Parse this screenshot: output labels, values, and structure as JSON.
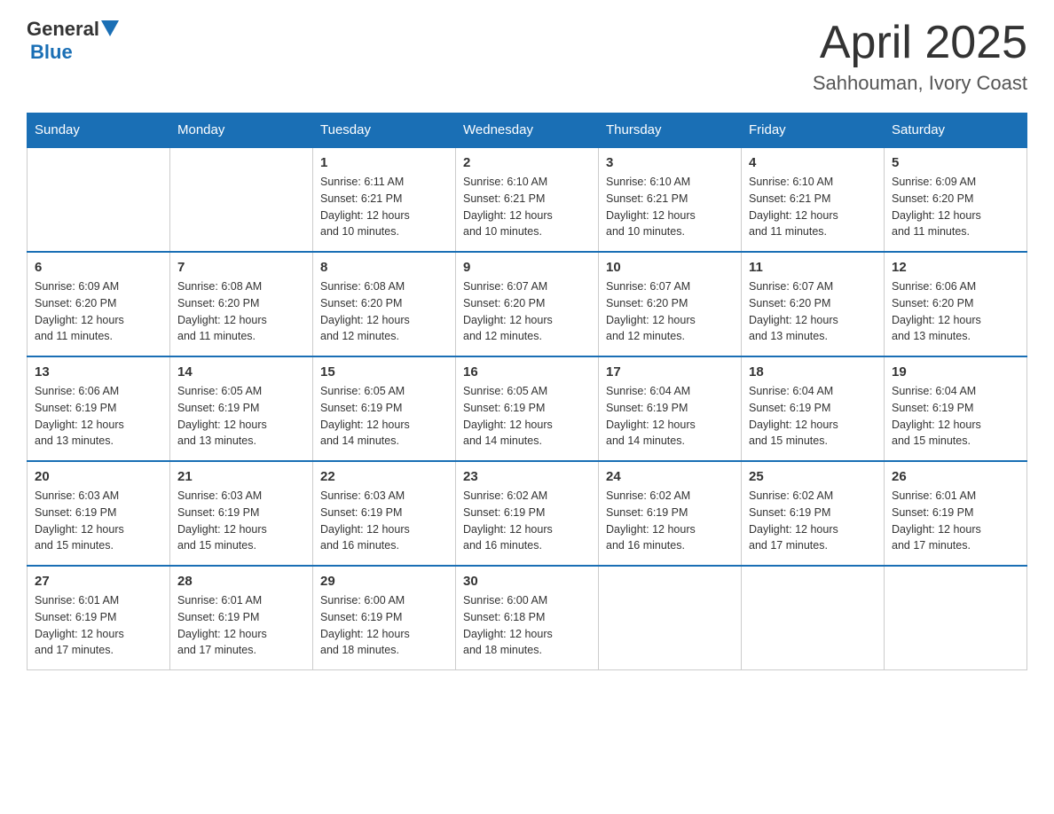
{
  "header": {
    "logo_general": "General",
    "logo_blue": "Blue",
    "title": "April 2025",
    "subtitle": "Sahhouman, Ivory Coast"
  },
  "days_of_week": [
    "Sunday",
    "Monday",
    "Tuesday",
    "Wednesday",
    "Thursday",
    "Friday",
    "Saturday"
  ],
  "weeks": [
    [
      {
        "day": "",
        "info": ""
      },
      {
        "day": "",
        "info": ""
      },
      {
        "day": "1",
        "info": "Sunrise: 6:11 AM\nSunset: 6:21 PM\nDaylight: 12 hours\nand 10 minutes."
      },
      {
        "day": "2",
        "info": "Sunrise: 6:10 AM\nSunset: 6:21 PM\nDaylight: 12 hours\nand 10 minutes."
      },
      {
        "day": "3",
        "info": "Sunrise: 6:10 AM\nSunset: 6:21 PM\nDaylight: 12 hours\nand 10 minutes."
      },
      {
        "day": "4",
        "info": "Sunrise: 6:10 AM\nSunset: 6:21 PM\nDaylight: 12 hours\nand 11 minutes."
      },
      {
        "day": "5",
        "info": "Sunrise: 6:09 AM\nSunset: 6:20 PM\nDaylight: 12 hours\nand 11 minutes."
      }
    ],
    [
      {
        "day": "6",
        "info": "Sunrise: 6:09 AM\nSunset: 6:20 PM\nDaylight: 12 hours\nand 11 minutes."
      },
      {
        "day": "7",
        "info": "Sunrise: 6:08 AM\nSunset: 6:20 PM\nDaylight: 12 hours\nand 11 minutes."
      },
      {
        "day": "8",
        "info": "Sunrise: 6:08 AM\nSunset: 6:20 PM\nDaylight: 12 hours\nand 12 minutes."
      },
      {
        "day": "9",
        "info": "Sunrise: 6:07 AM\nSunset: 6:20 PM\nDaylight: 12 hours\nand 12 minutes."
      },
      {
        "day": "10",
        "info": "Sunrise: 6:07 AM\nSunset: 6:20 PM\nDaylight: 12 hours\nand 12 minutes."
      },
      {
        "day": "11",
        "info": "Sunrise: 6:07 AM\nSunset: 6:20 PM\nDaylight: 12 hours\nand 13 minutes."
      },
      {
        "day": "12",
        "info": "Sunrise: 6:06 AM\nSunset: 6:20 PM\nDaylight: 12 hours\nand 13 minutes."
      }
    ],
    [
      {
        "day": "13",
        "info": "Sunrise: 6:06 AM\nSunset: 6:19 PM\nDaylight: 12 hours\nand 13 minutes."
      },
      {
        "day": "14",
        "info": "Sunrise: 6:05 AM\nSunset: 6:19 PM\nDaylight: 12 hours\nand 13 minutes."
      },
      {
        "day": "15",
        "info": "Sunrise: 6:05 AM\nSunset: 6:19 PM\nDaylight: 12 hours\nand 14 minutes."
      },
      {
        "day": "16",
        "info": "Sunrise: 6:05 AM\nSunset: 6:19 PM\nDaylight: 12 hours\nand 14 minutes."
      },
      {
        "day": "17",
        "info": "Sunrise: 6:04 AM\nSunset: 6:19 PM\nDaylight: 12 hours\nand 14 minutes."
      },
      {
        "day": "18",
        "info": "Sunrise: 6:04 AM\nSunset: 6:19 PM\nDaylight: 12 hours\nand 15 minutes."
      },
      {
        "day": "19",
        "info": "Sunrise: 6:04 AM\nSunset: 6:19 PM\nDaylight: 12 hours\nand 15 minutes."
      }
    ],
    [
      {
        "day": "20",
        "info": "Sunrise: 6:03 AM\nSunset: 6:19 PM\nDaylight: 12 hours\nand 15 minutes."
      },
      {
        "day": "21",
        "info": "Sunrise: 6:03 AM\nSunset: 6:19 PM\nDaylight: 12 hours\nand 15 minutes."
      },
      {
        "day": "22",
        "info": "Sunrise: 6:03 AM\nSunset: 6:19 PM\nDaylight: 12 hours\nand 16 minutes."
      },
      {
        "day": "23",
        "info": "Sunrise: 6:02 AM\nSunset: 6:19 PM\nDaylight: 12 hours\nand 16 minutes."
      },
      {
        "day": "24",
        "info": "Sunrise: 6:02 AM\nSunset: 6:19 PM\nDaylight: 12 hours\nand 16 minutes."
      },
      {
        "day": "25",
        "info": "Sunrise: 6:02 AM\nSunset: 6:19 PM\nDaylight: 12 hours\nand 17 minutes."
      },
      {
        "day": "26",
        "info": "Sunrise: 6:01 AM\nSunset: 6:19 PM\nDaylight: 12 hours\nand 17 minutes."
      }
    ],
    [
      {
        "day": "27",
        "info": "Sunrise: 6:01 AM\nSunset: 6:19 PM\nDaylight: 12 hours\nand 17 minutes."
      },
      {
        "day": "28",
        "info": "Sunrise: 6:01 AM\nSunset: 6:19 PM\nDaylight: 12 hours\nand 17 minutes."
      },
      {
        "day": "29",
        "info": "Sunrise: 6:00 AM\nSunset: 6:19 PM\nDaylight: 12 hours\nand 18 minutes."
      },
      {
        "day": "30",
        "info": "Sunrise: 6:00 AM\nSunset: 6:18 PM\nDaylight: 12 hours\nand 18 minutes."
      },
      {
        "day": "",
        "info": ""
      },
      {
        "day": "",
        "info": ""
      },
      {
        "day": "",
        "info": ""
      }
    ]
  ]
}
